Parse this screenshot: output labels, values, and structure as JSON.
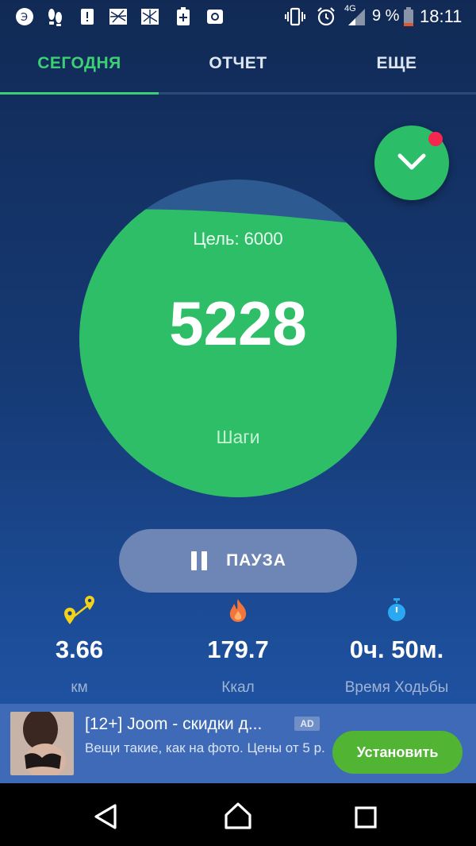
{
  "status_bar": {
    "battery_percent": "9 %",
    "network": "4G",
    "time": "18:11",
    "left_icons": [
      "app-icon-1",
      "footsteps-icon",
      "alert-icon",
      "photo-icon-1",
      "photo-icon-2",
      "battery-plus-icon",
      "camera-icon"
    ]
  },
  "tabs": [
    {
      "label": "СЕГОДНЯ",
      "active": true
    },
    {
      "label": "ОТЧЕТ",
      "active": false
    },
    {
      "label": "ЕЩЕ",
      "active": false
    }
  ],
  "progress": {
    "goal_text": "Цель: 6000",
    "steps": "5228",
    "steps_label": "Шаги",
    "fraction": 0.871
  },
  "pause_button": {
    "label": "ПАУЗА"
  },
  "stats": [
    {
      "value": "3.66",
      "label": "км",
      "icon": "route-pin-icon"
    },
    {
      "value": "179.7",
      "label": "Ккал",
      "icon": "flame-icon"
    },
    {
      "value": "0ч. 50м.",
      "label": "Время Ходьбы",
      "icon": "stopwatch-icon"
    }
  ],
  "ad": {
    "title": "[12+] Joom - скидки д...",
    "badge": "AD",
    "description": "Вещи такие, как на фото. Цены от 5 р.",
    "button": "Установить"
  },
  "colors": {
    "accent_green": "#3ccf75",
    "circle_green": "#2dbe67",
    "fab_dot": "#f3274f",
    "ad_button": "#51b533"
  }
}
